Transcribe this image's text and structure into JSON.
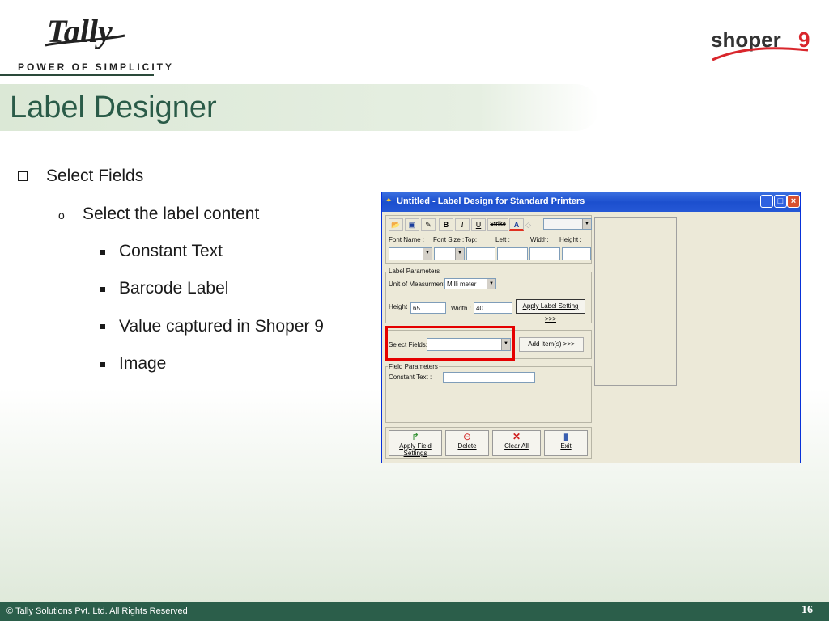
{
  "brand": {
    "tally_logo_text": "Tally",
    "tagline": "POWER OF SIMPLICITY",
    "shoper_logo_text": "shoper",
    "shoper_logo_number": "9"
  },
  "slide": {
    "title": "Label Designer",
    "bullet_1": "Select Fields",
    "bullet_1_1": "Select the label content",
    "sub_bullets": [
      "Constant Text",
      "Barcode Label",
      "Value captured in Shoper 9",
      "Image"
    ]
  },
  "window": {
    "title": "Untitled - Label Design for Standard Printers",
    "toolbar": {
      "bold": "B",
      "italic": "I",
      "underline": "U",
      "strike": "Strike",
      "color": "A"
    },
    "font_labels": {
      "font_name": "Font Name :",
      "font_size": "Font Size :",
      "top": "Top:",
      "left": "Left :",
      "width": "Width:",
      "height": "Height :"
    },
    "label_params": {
      "legend": "Label Parameters",
      "unit_label": "Unit of Measurment :",
      "unit_value": "Milli meter",
      "height_label": "Height :",
      "height_value": "65",
      "width_label": "Width :",
      "width_value": "40",
      "apply_button": "Apply Label Setting >>>"
    },
    "select_fields": {
      "label": "Select Fields:",
      "value": "",
      "add_button": "Add Item(s) >>>"
    },
    "field_params": {
      "legend": "Field Parameters",
      "constant_label": "Constant Text :",
      "constant_value": ""
    },
    "actions": {
      "apply": "Apply Field Settings",
      "delete": "Delete",
      "clear": "Clear All",
      "exit": "Exit"
    }
  },
  "footer": {
    "copyright": "© Tally Solutions Pvt. Ltd. All Rights Reserved",
    "page": "16"
  },
  "colors": {
    "accent": "#2b5e4a",
    "title": "#2a5b48",
    "highlight": "#e50000"
  }
}
